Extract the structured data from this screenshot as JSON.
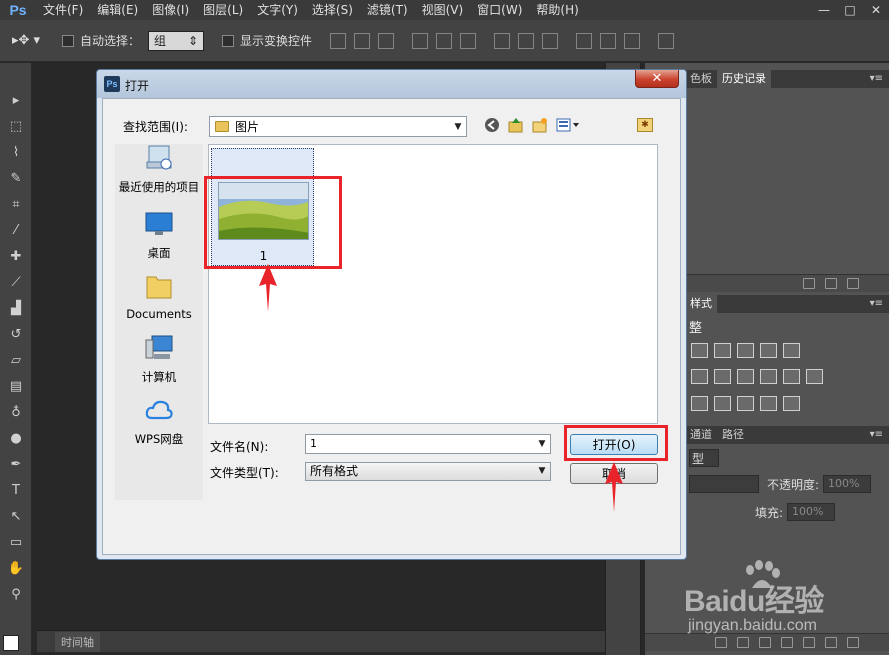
{
  "app": {
    "logo": "Ps",
    "menu": [
      "文件(F)",
      "编辑(E)",
      "图像(I)",
      "图层(L)",
      "文字(Y)",
      "选择(S)",
      "滤镜(T)",
      "视图(V)",
      "窗口(W)",
      "帮助(H)"
    ],
    "window_controls": {
      "minimize": "—",
      "maximize": "□",
      "close": "✕"
    }
  },
  "options": {
    "auto_select_label": "自动选择：",
    "auto_select_value": "组",
    "show_transform_label": "显示变换控件"
  },
  "workspace": {
    "timeline_label": "时间轴"
  },
  "panels": {
    "top_tabs": [
      "色板",
      "历史记录"
    ],
    "style_tab": "样式",
    "adjust_partial": "整",
    "layer_tabs": [
      "通道",
      "路径"
    ],
    "kind_partial": "型",
    "opacity_label": "不透明度:",
    "opacity_value": "100%",
    "fill_label": "填充:",
    "fill_value": "100%"
  },
  "dialog": {
    "title": "打开",
    "close_symbol": "✕",
    "look_in_label": "查找范围(I):",
    "look_in_value": "图片",
    "places": [
      {
        "label": "最近使用的项目",
        "icon": "recent-items-icon"
      },
      {
        "label": "桌面",
        "icon": "desktop-icon"
      },
      {
        "label": "Documents",
        "icon": "documents-folder-icon"
      },
      {
        "label": "计算机",
        "icon": "computer-icon"
      },
      {
        "label": "WPS网盘",
        "icon": "cloud-icon"
      }
    ],
    "file": {
      "name": "1"
    },
    "filename_label": "文件名(N):",
    "filename_value": "1",
    "filetype_label": "文件类型(T):",
    "filetype_value": "所有格式",
    "open_label": "打开(O)",
    "cancel_label": "取消"
  },
  "watermark": {
    "brand": "Baidu经验",
    "url": "jingyan.baidu.com"
  },
  "colors": {
    "highlight": "#e8242a",
    "dialog_border": "#5a7aa0",
    "ps_bg": "#282828"
  }
}
